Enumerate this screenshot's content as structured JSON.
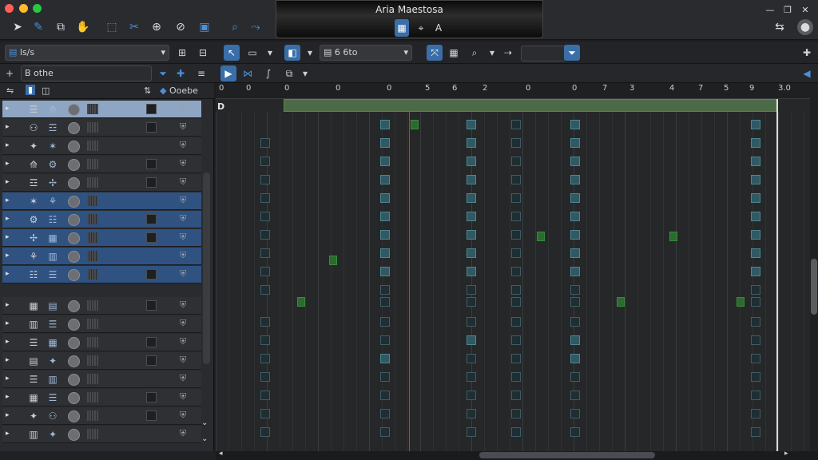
{
  "window": {
    "title": "Aria Maestosa"
  },
  "title_segments": [
    "▦",
    "⌖",
    "A"
  ],
  "toolbar2": {
    "left_field": "ls/s",
    "mid_field": "6 6to"
  },
  "toolbar3": {
    "search_label": "B othe",
    "track_col_label": "Ooebe"
  },
  "ruler_ticks": [
    "0",
    "0",
    "0",
    "0",
    "0",
    "5",
    "6",
    "2",
    "0",
    "0",
    "7",
    "3",
    "4",
    "7",
    "5",
    "9",
    "3.0"
  ],
  "colors": {
    "accent": "#3a6ea8",
    "selection_row": "#2f5281",
    "playhead": "#2c6fb5",
    "region": "#4b6a45"
  }
}
